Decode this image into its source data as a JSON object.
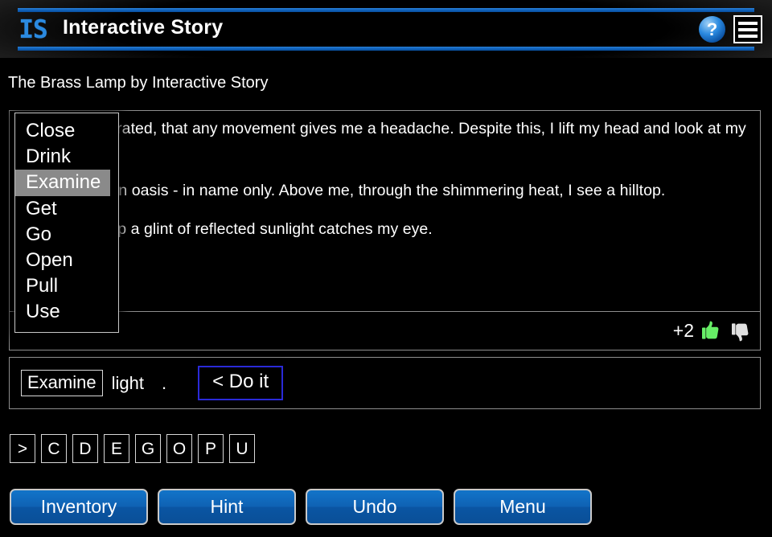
{
  "header": {
    "logo_text": "IS",
    "app_title": "Interactive Story",
    "help_label": "?",
    "help_icon_name": "help-icon",
    "menu_icon_name": "hamburger-menu-icon",
    "accent_color": "#0f63bd"
  },
  "story": {
    "title": "The Brass Lamp by Interactive Story",
    "paragraphs": [
      "I am so dehydrated, that any movement gives me a headache. Despite this, I lift my head and look at my surroundings.",
      "I see what is an oasis - in name only. Above me, through the shimmering heat, I see a hilltop.",
      "From the hilltop a glint of reflected sunlight catches my eye."
    ],
    "rating": {
      "score": "+2",
      "thumbs_up_name": "thumbs-up-icon",
      "thumbs_down_name": "thumbs-down-icon",
      "thumbs_up_color": "#66ee66",
      "thumbs_down_color": "#e0e0e0"
    }
  },
  "command": {
    "verb": "Examine",
    "noun": "light",
    "period": ".",
    "do_it_label": "< Do it",
    "do_it_border_color": "#2a2ad8"
  },
  "verb_dropdown": {
    "selected": "Examine",
    "options": [
      {
        "label": "Close"
      },
      {
        "label": "Drink"
      },
      {
        "label": "Examine"
      },
      {
        "label": "Get"
      },
      {
        "label": "Go"
      },
      {
        "label": "Open"
      },
      {
        "label": "Pull"
      },
      {
        "label": "Use"
      }
    ],
    "highlight_color": "#8a8a8a"
  },
  "letter_keys": [
    {
      "label": ">"
    },
    {
      "label": "C"
    },
    {
      "label": "D"
    },
    {
      "label": "E"
    },
    {
      "label": "G"
    },
    {
      "label": "O"
    },
    {
      "label": "P"
    },
    {
      "label": "U"
    }
  ],
  "actions": [
    {
      "label": "Inventory"
    },
    {
      "label": "Hint"
    },
    {
      "label": "Undo"
    },
    {
      "label": "Menu"
    }
  ]
}
